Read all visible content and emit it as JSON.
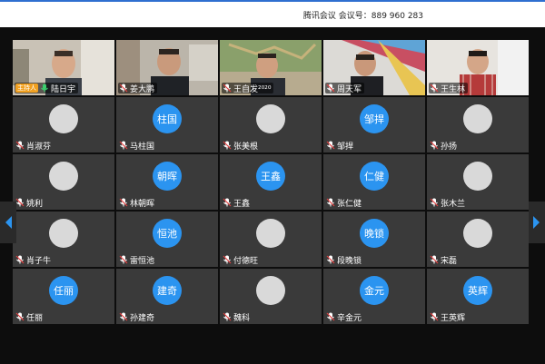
{
  "window": {
    "title": "腾讯会议 会议号：889 960 283",
    "accent": "#2f6fd0"
  },
  "navigation": {
    "prev_icon": "chevron-left-icon",
    "next_icon": "chevron-right-icon",
    "arrow_color": "#2b94f0"
  },
  "participants": [
    {
      "name": "陆日宇",
      "host_label": "主持人",
      "video": true,
      "mic": "on",
      "scene": "office-man"
    },
    {
      "name": "姜大鹏",
      "video": true,
      "mic": "muted",
      "scene": "home-man"
    },
    {
      "name": "王自发²⁰²⁰",
      "video": true,
      "mic": "muted",
      "scene": "map-man"
    },
    {
      "name": "周天军",
      "video": true,
      "mic": "muted",
      "scene": "art-man"
    },
    {
      "name": "王生林",
      "video": true,
      "mic": "muted",
      "scene": "plaid-man"
    },
    {
      "name": "肖淑芬",
      "avatar": "image",
      "mic": "muted"
    },
    {
      "name": "马柱国",
      "avatar_text": "柱国",
      "mic": "muted"
    },
    {
      "name": "张美根",
      "avatar": "image",
      "mic": "muted"
    },
    {
      "name": "邹捍",
      "avatar_text": "邹捍",
      "mic": "muted"
    },
    {
      "name": "孙扬",
      "avatar": "image",
      "mic": "muted"
    },
    {
      "name": "姚利",
      "avatar": "image",
      "mic": "muted"
    },
    {
      "name": "林朝晖",
      "avatar_text": "朝晖",
      "mic": "muted"
    },
    {
      "name": "王鑫",
      "avatar_text": "王鑫",
      "mic": "muted"
    },
    {
      "name": "张仁健",
      "avatar_text": "仁健",
      "mic": "muted"
    },
    {
      "name": "张木兰",
      "avatar": "image",
      "mic": "muted"
    },
    {
      "name": "肖子牛",
      "avatar": "image",
      "mic": "muted"
    },
    {
      "name": "雷恒池",
      "avatar_text": "恒池",
      "mic": "muted"
    },
    {
      "name": "付德旺",
      "avatar": "image",
      "mic": "muted"
    },
    {
      "name": "段晚锁",
      "avatar_text": "晚锁",
      "mic": "muted"
    },
    {
      "name": "宋磊",
      "avatar": "image",
      "mic": "muted"
    },
    {
      "name": "任丽",
      "avatar_text": "任丽",
      "mic": "muted"
    },
    {
      "name": "孙建奇",
      "avatar_text": "建奇",
      "mic": "muted"
    },
    {
      "name": "魏科",
      "avatar": "image",
      "mic": "muted"
    },
    {
      "name": "辛金元",
      "avatar_text": "金元",
      "mic": "muted"
    },
    {
      "name": "王英辉",
      "avatar_text": "英辉",
      "mic": "muted"
    }
  ]
}
